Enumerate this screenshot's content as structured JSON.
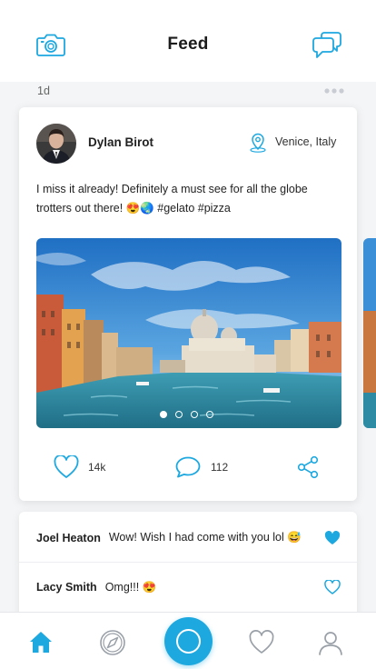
{
  "header": {
    "title": "Feed"
  },
  "post": {
    "age": "1d",
    "user": "Dylan Birot",
    "location": "Venice, Italy",
    "caption": "I miss it already! Definitely a must see for all the globe trotters out there! 😍🌏 #gelato #pizza",
    "likes": "14k",
    "comments": "112",
    "carousel": {
      "count": 4,
      "active": 0
    }
  },
  "comments": [
    {
      "name": "Joel Heaton",
      "text": "Wow! Wish I had come with you lol 😅",
      "liked": true
    },
    {
      "name": "Lacy Smith",
      "text": "Omg!!! 😍",
      "liked": false
    }
  ],
  "tabs": [
    {
      "id": "home",
      "icon": "home-icon",
      "active": true
    },
    {
      "id": "explore",
      "icon": "compass-icon",
      "active": false
    },
    {
      "id": "capture",
      "icon": "circle-icon",
      "active": false
    },
    {
      "id": "favorites",
      "icon": "heart-icon",
      "active": false
    },
    {
      "id": "profile",
      "icon": "user-icon",
      "active": false
    }
  ],
  "colors": {
    "accent": "#1da8e0",
    "text": "#1c1c1c",
    "background": "#f4f5f7"
  }
}
